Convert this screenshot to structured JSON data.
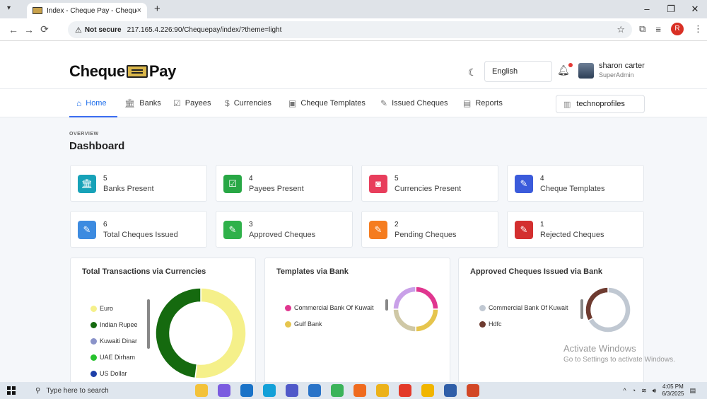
{
  "browser": {
    "tab_title": "Index - Cheque Pay - Cheque P",
    "tab_close": "×",
    "new_tab": "+",
    "not_secure": "Not secure",
    "url": "217.165.4.226:90/Chequepay/index/?theme=light",
    "profile_initial": "R"
  },
  "header": {
    "logo_left": "Cheque",
    "logo_right": "Pay",
    "language": "English",
    "user_name": "sharon carter",
    "user_role": "SuperAdmin"
  },
  "menu": {
    "items": [
      {
        "label": "Home",
        "icon": "home-icon"
      },
      {
        "label": "Banks",
        "icon": "bank-icon"
      },
      {
        "label": "Payees",
        "icon": "check-square-icon"
      },
      {
        "label": "Currencies",
        "icon": "dollar-icon"
      },
      {
        "label": "Cheque Templates",
        "icon": "template-icon"
      },
      {
        "label": "Issued Cheques",
        "icon": "pen-icon"
      },
      {
        "label": "Reports",
        "icon": "report-icon"
      }
    ],
    "company": "technoprofiles"
  },
  "page": {
    "overline": "OVERVIEW",
    "title": "Dashboard"
  },
  "stats": [
    {
      "value": "5",
      "label": "Banks Present",
      "color": "#17a2b8",
      "icon": "bank-icon"
    },
    {
      "value": "4",
      "label": "Payees Present",
      "color": "#28a745",
      "icon": "check-square-icon"
    },
    {
      "value": "5",
      "label": "Currencies Present",
      "color": "#e83e5c",
      "icon": "currency-icon"
    },
    {
      "value": "4",
      "label": "Cheque Templates",
      "color": "#3b5bdb",
      "icon": "pen-icon"
    },
    {
      "value": "6",
      "label": "Total Cheques Issued",
      "color": "#3d8be0",
      "icon": "pen-icon"
    },
    {
      "value": "3",
      "label": "Approved Cheques",
      "color": "#2fb14a",
      "icon": "pen-icon"
    },
    {
      "value": "2",
      "label": "Pending Cheques",
      "color": "#f57c1f",
      "icon": "pen-icon"
    },
    {
      "value": "1",
      "label": "Rejected Cheques",
      "color": "#d32f2f",
      "icon": "pen-icon"
    }
  ],
  "charts": {
    "c1_title": "Total Transactions via Currencies",
    "c2_title": "Templates via Bank",
    "c3_title": "Approved Cheques Issued via Bank"
  },
  "chart_data": [
    {
      "type": "pie",
      "title": "Total Transactions via Currencies",
      "categories": [
        "Euro",
        "Indian Rupee",
        "Kuwaiti Dinar",
        "UAE Dirham",
        "US Dollar"
      ],
      "values": [
        52,
        48,
        0,
        0,
        0
      ],
      "colors": [
        "#f5f08a",
        "#156a0f",
        "#8a93c9",
        "#27c22e",
        "#1d3fa8"
      ],
      "visible_legend": [
        "Euro",
        "Indian Rupee",
        "Kuwaiti Dinar",
        "UAE Dirham",
        "US Dollar"
      ]
    },
    {
      "type": "pie",
      "title": "Templates via Bank",
      "categories": [
        "Commercial Bank Of Kuwait",
        "Gulf Bank",
        "",
        ""
      ],
      "values": [
        25,
        25,
        25,
        25
      ],
      "colors": [
        "#e0368f",
        "#e6c54e",
        "#cfc8a6",
        "#c9a0e8"
      ]
    },
    {
      "type": "pie",
      "title": "Approved Cheques Issued via Bank",
      "categories": [
        "Commercial Bank Of Kuwait",
        "Hdfc"
      ],
      "values": [
        67,
        33
      ],
      "colors": [
        "#c0c8d2",
        "#6e3b30"
      ]
    }
  ],
  "watermark": {
    "line1": "Activate Windows",
    "line2": "Go to Settings to activate Windows."
  },
  "taskbar": {
    "search_placeholder": "Type here to search",
    "time": "4:05 PM",
    "date": "6/3/2025"
  }
}
